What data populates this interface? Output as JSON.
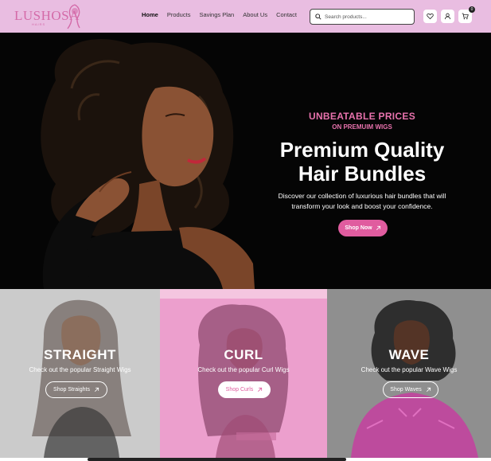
{
  "brand": {
    "name": "LUSHOSA",
    "tagline": "HAIRS"
  },
  "nav": {
    "items": [
      {
        "label": "Home",
        "active": true
      },
      {
        "label": "Products",
        "active": false
      },
      {
        "label": "Savings Plan",
        "active": false
      },
      {
        "label": "About Us",
        "active": false
      },
      {
        "label": "Contact",
        "active": false
      }
    ]
  },
  "search": {
    "placeholder": "Search products..."
  },
  "cart": {
    "count": "0"
  },
  "hero": {
    "kicker": "UNBEATABLE PRICES",
    "kicker_sub": "ON PREMUIM WIGS",
    "title_line1": "Premium Quality",
    "title_line2": "Hair Bundles",
    "desc_line1": "Discover our collection of luxurious hair bundles that will",
    "desc_line2": "transform your look and boost your confidence.",
    "cta": "Shop Now"
  },
  "categories": [
    {
      "title": "STRAIGHT",
      "subtitle": "Check out the popular Straight Wigs",
      "cta": "Shop Straights"
    },
    {
      "title": "CURL",
      "subtitle": "Check out the popular Curl Wigs",
      "cta": "Shop Curls"
    },
    {
      "title": "WAVE",
      "subtitle": "Check out the popular Wave Wigs",
      "cta": "Shop Waves"
    }
  ],
  "colors": {
    "header_bg": "#e9bde1",
    "accent": "#e05c9f",
    "hero_bg": "#050505"
  },
  "icons": [
    "heart-icon",
    "user-icon",
    "cart-icon",
    "search-icon",
    "arrow-up-right-icon"
  ]
}
